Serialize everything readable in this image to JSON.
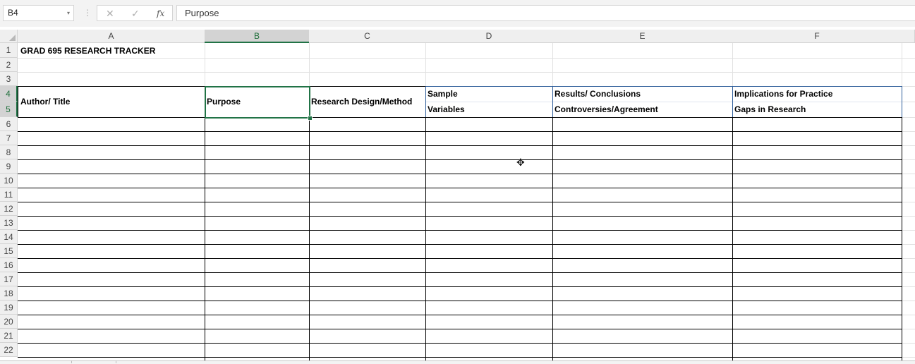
{
  "formula_bar": {
    "name_box": "B4",
    "dropdown_glyph": "▾",
    "dots": "⋮",
    "cancel_glyph": "✕",
    "enter_glyph": "✓",
    "fx_glyph": "fx",
    "formula": "Purpose"
  },
  "columns": [
    "A",
    "B",
    "C",
    "D",
    "E",
    "F"
  ],
  "rows": [
    "1",
    "2",
    "3",
    "4",
    "5",
    "6",
    "7",
    "8",
    "9",
    "10",
    "11",
    "12",
    "13",
    "14",
    "15",
    "16",
    "17",
    "18",
    "19",
    "20",
    "21",
    "22"
  ],
  "selected": {
    "column": "B",
    "rows": [
      "4",
      "5"
    ]
  },
  "cells": {
    "title": "GRAD 695 RESEARCH TRACKER",
    "a_header": "Author/ Title",
    "b_header": "Purpose",
    "c_header": "Research Design/Method",
    "d_header_1": "Sample",
    "d_header_2": "Variables",
    "e_header_1": "Results/ Conclusions",
    "e_header_2": "Controversies/Agreement",
    "f_header_1": "Implications for Practice",
    "f_header_2": "Gaps in Research"
  },
  "colors": {
    "selection": "#217346",
    "header_border": "#2e5d9a"
  }
}
